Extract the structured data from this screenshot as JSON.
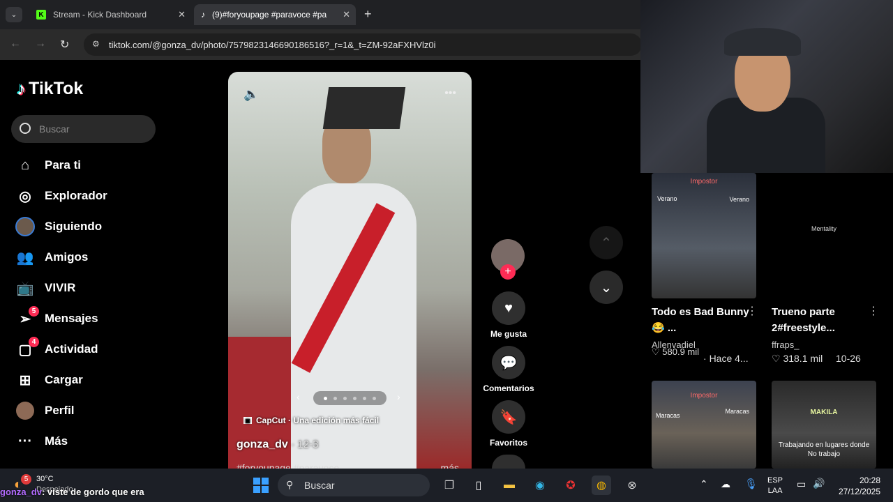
{
  "browser": {
    "tabs": [
      {
        "title": "Stream - Kick Dashboard",
        "icon": "kick-icon"
      },
      {
        "title": "(9)#foryoupage #paravoce #pa",
        "icon": "tiktok-icon"
      }
    ],
    "url": "tiktok.com/@gonza_dv/photo/7579823146690186516?_r=1&_t=ZM-92aFXHVlz0i"
  },
  "sidebar": {
    "logo": "TikTok",
    "search_placeholder": "Buscar",
    "items": [
      {
        "label": "Para ti",
        "icon": "home-icon"
      },
      {
        "label": "Explorador",
        "icon": "compass-icon"
      },
      {
        "label": "Siguiendo",
        "icon": "following-avatar-icon"
      },
      {
        "label": "Amigos",
        "icon": "friends-icon"
      },
      {
        "label": "VIVIR",
        "icon": "live-icon"
      },
      {
        "label": "Mensajes",
        "icon": "messages-icon",
        "badge": "5"
      },
      {
        "label": "Actividad",
        "icon": "activity-icon",
        "badge": "4"
      },
      {
        "label": "Cargar",
        "icon": "upload-icon"
      },
      {
        "label": "Perfil",
        "icon": "profile-avatar-icon"
      },
      {
        "label": "Más",
        "icon": "more-icon"
      }
    ]
  },
  "post": {
    "capcut": "CapCut · Una edición más fácil",
    "author": "gonza_dv",
    "date": "· 12-3",
    "tags": "#foryoupage #paravoce",
    "more": "más",
    "slide_count": 6,
    "active_slide": 1
  },
  "actions": {
    "like": "Me gusta",
    "comments": "Comentarios",
    "favorites": "Favoritos"
  },
  "feed": [
    {
      "overlay": "Impostor",
      "labels": [
        "Verano",
        "Verano"
      ],
      "title": "Todo es Bad Bunny 😂 ...",
      "author": "Allenvadiel",
      "likes": "580.9 mil",
      "date": "Hace 4..."
    },
    {
      "overlay": "Mentality",
      "labels": [],
      "title": "Trueno parte 2#freestyle...",
      "author": "ffraps_",
      "likes": "318.1 mil",
      "date": "10-26"
    },
    {
      "overlay": "Impostor",
      "labels": [
        "Maracas",
        "Maracas"
      ],
      "title": "",
      "author": "",
      "likes": "",
      "date": ""
    },
    {
      "overlay": "Trabajando en lugares donde No trabajo",
      "labels": [
        "MAKILA"
      ],
      "title": "",
      "author": "",
      "likes": "",
      "date": ""
    }
  ],
  "taskbar": {
    "weather_temp": "30°C",
    "weather_sub": "Despejado",
    "weather_badge": "5",
    "search": "Buscar",
    "lang_top": "ESP",
    "lang_bottom": "LAA",
    "time": "20:28",
    "date": "27/12/2025"
  },
  "stream_chat": {
    "user": "gonza_dv",
    "message": ": viste de gordo que era"
  },
  "colors": {
    "accent": "#fe2c55",
    "kick": "#53fc18"
  }
}
